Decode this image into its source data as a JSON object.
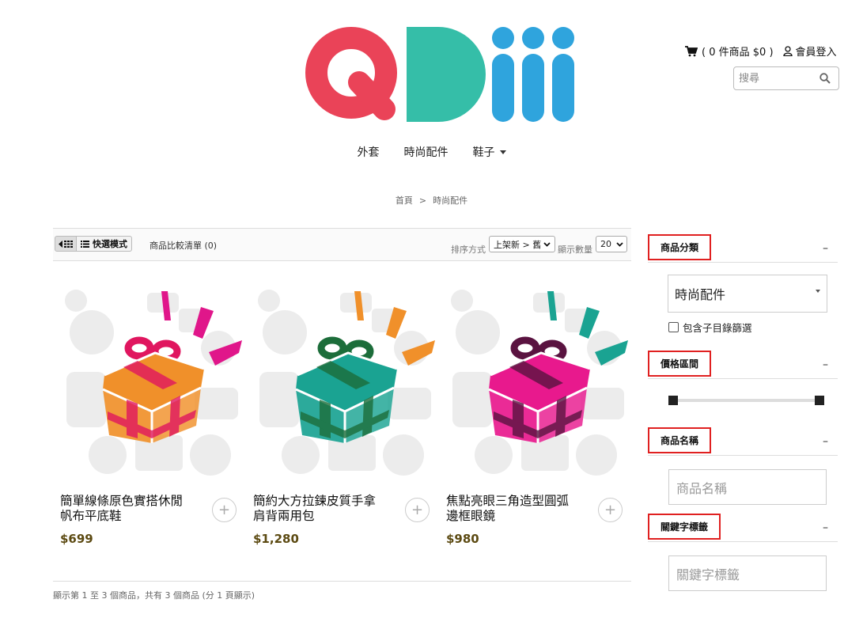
{
  "brand": {
    "logo_text": "QDiii",
    "colors": {
      "q": "#ea4358",
      "d": "#35bea8",
      "iii": "#2fa4dd"
    }
  },
  "header": {
    "cart_open": "(",
    "cart_text": "0 件商品 $0",
    "cart_close": ")",
    "login_label": "會員登入",
    "search_placeholder": "搜尋"
  },
  "nav": {
    "items": [
      "外套",
      "時尚配件",
      "鞋子"
    ]
  },
  "breadcrumb": {
    "home": "首頁",
    "separator": ">",
    "current": "時尚配件"
  },
  "toolbar": {
    "quick_mode_label": "快選模式",
    "compare_label": "商品比較清單 (0)",
    "sort_label": "排序方式",
    "sort_value": "上架新 > 舊",
    "qty_label": "顯示數量",
    "qty_value": "20"
  },
  "products": [
    {
      "name": "簡單線條原色實搭休閒帆布平底鞋",
      "price": "$699",
      "box_color": "#f0902a",
      "ribbon_color": "#e0165f",
      "accent_color": "#e0168a"
    },
    {
      "name": "簡約大方拉鍊皮質手拿肩背兩用包",
      "price": "$1,280",
      "box_color": "#1aa392",
      "ribbon_color": "#1c6d3a",
      "accent_color": "#f0902a"
    },
    {
      "name": "焦點亮眼三角造型圓弧邊框眼鏡",
      "price": "$980",
      "box_color": "#e8198d",
      "ribbon_color": "#5a1340",
      "accent_color": "#1aa392"
    }
  ],
  "add_button_label": "+",
  "showing_text": "顯示第 1 至 3 個商品，共有 3 個商品 (分 1 頁顯示)",
  "sidebar": {
    "category": {
      "title": "商品分類",
      "collapse": "–",
      "selected": "時尚配件",
      "include_sub_label": "包含子目錄篩選"
    },
    "price": {
      "title": "價格區間",
      "collapse": "–"
    },
    "name": {
      "title": "商品名稱",
      "collapse": "–",
      "placeholder": "商品名稱"
    },
    "keyword": {
      "title": "關鍵字標籤",
      "collapse": "–",
      "placeholder": "關鍵字標籤"
    }
  }
}
